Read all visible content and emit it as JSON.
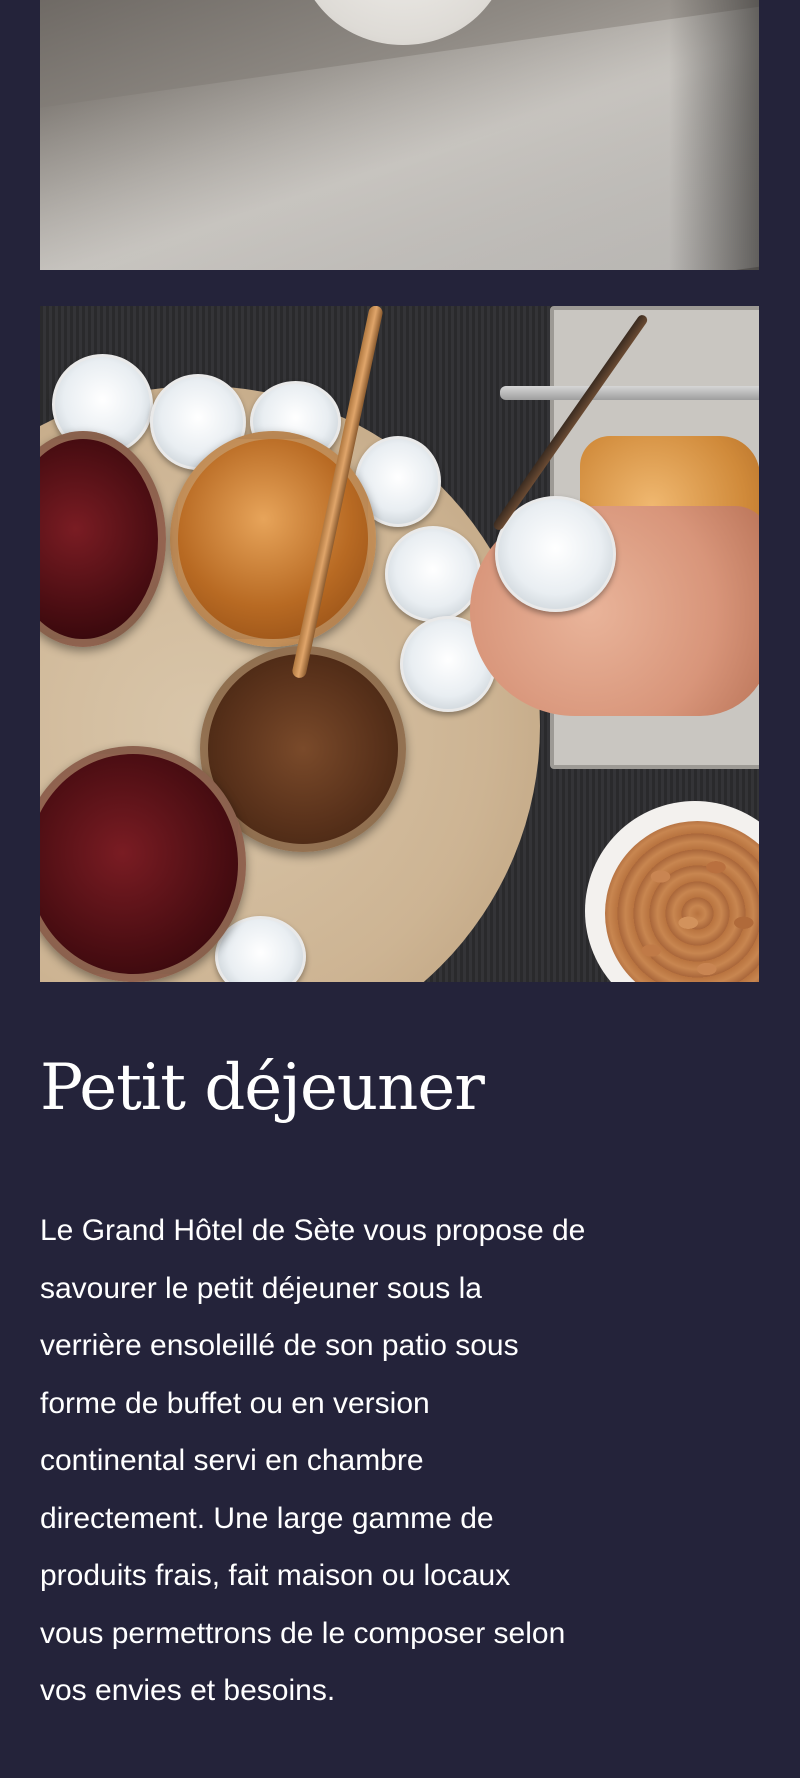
{
  "breakfast": {
    "title": "Petit déjeuner",
    "description": "Le Grand Hôtel de Sète vous propose de\nsavourer le petit déjeuner sous la\nverrière ensoleillé de son patio sous\nforme de buffet ou en version\ncontinental servi en chambre\ndirectement. Une large gamme de\nproduits frais, fait maison ou locaux\nvous permettrons de le composer selon\nvos envies et besoins."
  },
  "colors": {
    "background": "#24233a",
    "text": "#ffffff"
  }
}
